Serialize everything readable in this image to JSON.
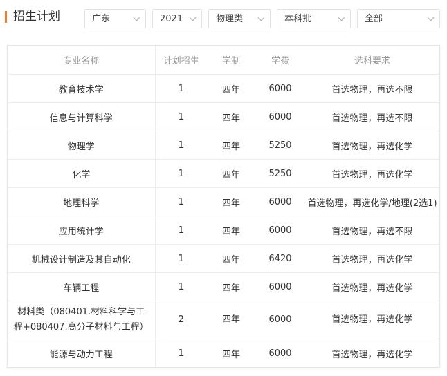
{
  "header": {
    "title": "招生计划",
    "filters": {
      "province": "广东",
      "year": "2021",
      "subject": "物理类",
      "batch": "本科批",
      "type": "全部"
    }
  },
  "table": {
    "columns": [
      "专业名称",
      "计划招生",
      "学制",
      "学费",
      "选科要求"
    ],
    "rows": [
      {
        "major": "教育技术学",
        "plan": "1",
        "duration": "四年",
        "fee": "6000",
        "req": "首选物理，再选不限"
      },
      {
        "major": "信息与计算科学",
        "plan": "1",
        "duration": "四年",
        "fee": "6000",
        "req": "首选物理，再选不限"
      },
      {
        "major": "物理学",
        "plan": "1",
        "duration": "四年",
        "fee": "5250",
        "req": "首选物理，再选化学"
      },
      {
        "major": "化学",
        "plan": "1",
        "duration": "四年",
        "fee": "5250",
        "req": "首选物理，再选化学"
      },
      {
        "major": "地理科学",
        "plan": "1",
        "duration": "四年",
        "fee": "6000",
        "req": "首选物理，再选化学/地理(2选1)"
      },
      {
        "major": "应用统计学",
        "plan": "1",
        "duration": "四年",
        "fee": "6000",
        "req": "首选物理，再选不限"
      },
      {
        "major": "机械设计制造及其自动化",
        "plan": "1",
        "duration": "四年",
        "fee": "6420",
        "req": "首选物理，再选化学"
      },
      {
        "major": "车辆工程",
        "plan": "1",
        "duration": "四年",
        "fee": "6000",
        "req": "首选物理，再选化学"
      },
      {
        "major_line1": "材料类（080401.材料科学与工",
        "major_line2": "程+080407.高分子材料与工程）",
        "plan": "2",
        "duration": "四年",
        "fee": "6000",
        "req": "首选物理，再选化学"
      },
      {
        "major": "能源与动力工程",
        "plan": "1",
        "duration": "四年",
        "fee": "6000",
        "req": "首选物理，再选化学"
      }
    ]
  }
}
